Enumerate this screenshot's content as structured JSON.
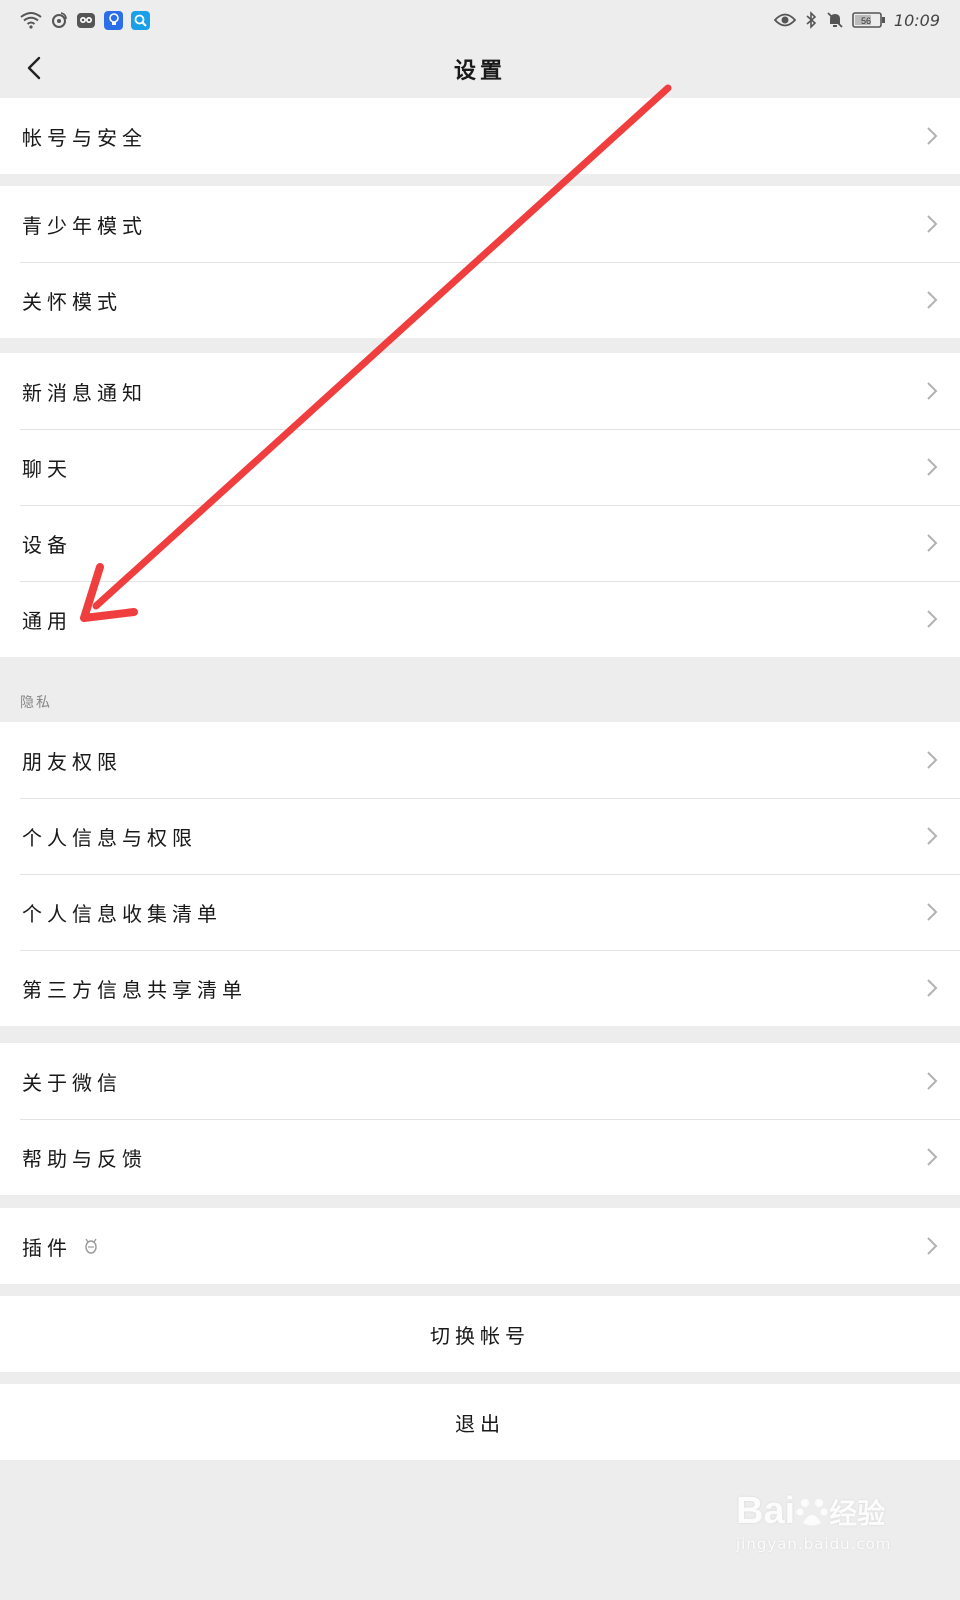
{
  "status_bar": {
    "time": "10:09",
    "battery": "56",
    "left_icons": [
      "wifi-icon",
      "weibo-icon",
      "owl-app-icon",
      "bulb-app-icon",
      "search-app-icon"
    ],
    "right_icons": [
      "eye-icon",
      "bluetooth-icon",
      "mute-bell-icon",
      "battery-icon"
    ]
  },
  "nav": {
    "title": "设置",
    "back_icon": "chevron-left-icon"
  },
  "groups": {
    "account": {
      "items": [
        {
          "label": "帐号与安全"
        }
      ]
    },
    "modes": {
      "items": [
        {
          "label": "青少年模式"
        },
        {
          "label": "关怀模式"
        }
      ]
    },
    "general": {
      "items": [
        {
          "label": "新消息通知"
        },
        {
          "label": "聊天"
        },
        {
          "label": "设备"
        },
        {
          "label": "通用"
        }
      ]
    },
    "privacy": {
      "section_label": "隐私",
      "items": [
        {
          "label": "朋友权限"
        },
        {
          "label": "个人信息与权限"
        },
        {
          "label": "个人信息收集清单"
        },
        {
          "label": "第三方信息共享清单"
        }
      ]
    },
    "about": {
      "items": [
        {
          "label": "关于微信"
        },
        {
          "label": "帮助与反馈"
        }
      ]
    },
    "plugins": {
      "items": [
        {
          "label": "插件",
          "icon": "plugin-bug-icon"
        }
      ]
    }
  },
  "actions": {
    "switch_account": "切换帐号",
    "logout": "退出"
  },
  "watermark": {
    "brand": "Bai",
    "brand_suffix": "经验",
    "url": "jingyan.baidu.com"
  },
  "colors": {
    "background": "#ededed",
    "cell": "#ffffff",
    "annotation_arrow": "#f03e3e",
    "chevron": "#b2b2b2"
  }
}
